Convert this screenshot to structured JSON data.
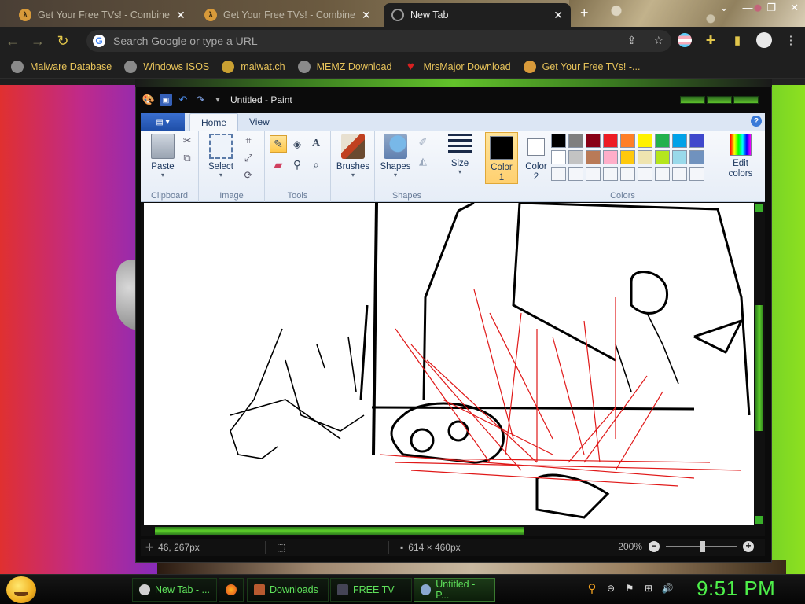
{
  "browser": {
    "tabs": [
      {
        "title": "Get Your Free TVs! - Combine C",
        "fav": "λ",
        "active": false
      },
      {
        "title": "Get Your Free TVs! - Combine C",
        "fav": "λ",
        "active": false
      },
      {
        "title": "New Tab",
        "fav": "",
        "active": true
      }
    ],
    "omnibox_placeholder": "Search Google or type a URL",
    "bookmarks": [
      "Malware Database",
      "Windows ISOS",
      "malwat.ch",
      "MEMZ Download",
      "MrsMajor Download",
      "Get Your Free TVs! -..."
    ]
  },
  "paint": {
    "window_title": "Untitled - Paint",
    "tabs": [
      "Home",
      "View"
    ],
    "groups": {
      "clipboard": {
        "label": "Clipboard",
        "paste": "Paste"
      },
      "image": {
        "label": "Image",
        "select": "Select"
      },
      "tools": {
        "label": "Tools"
      },
      "brushes": "Brushes",
      "shapes": {
        "label": "Shapes",
        "button": "Shapes"
      },
      "size": "Size",
      "colors": {
        "label": "Colors",
        "color1_a": "Color",
        "color1_b": "1",
        "color2_a": "Color",
        "color2_b": "2",
        "edit_a": "Edit",
        "edit_b": "colors",
        "color1_value": "#000000",
        "color2_value": "#ffffff",
        "palette": [
          "#000000",
          "#7f7f7f",
          "#880015",
          "#ed1c24",
          "#ff7f27",
          "#fff200",
          "#22b14c",
          "#00a2e8",
          "#3f48cc",
          "#a349a4",
          "#ffffff",
          "#c3c3c3",
          "#b97a57",
          "#ffaec9",
          "#ffc90e",
          "#efe4b0",
          "#b5e61d",
          "#99d9ea",
          "#7092be",
          "#c8bfe7"
        ]
      }
    },
    "status": {
      "cursor_pos": "46, 267px",
      "canvas_size": "614 × 460px",
      "zoom": "200%"
    }
  },
  "taskbar": {
    "tasks": [
      "New Tab - ...",
      "",
      "Downloads",
      "FREE TV",
      "Untitled - P..."
    ],
    "clock": "9:51 PM"
  }
}
